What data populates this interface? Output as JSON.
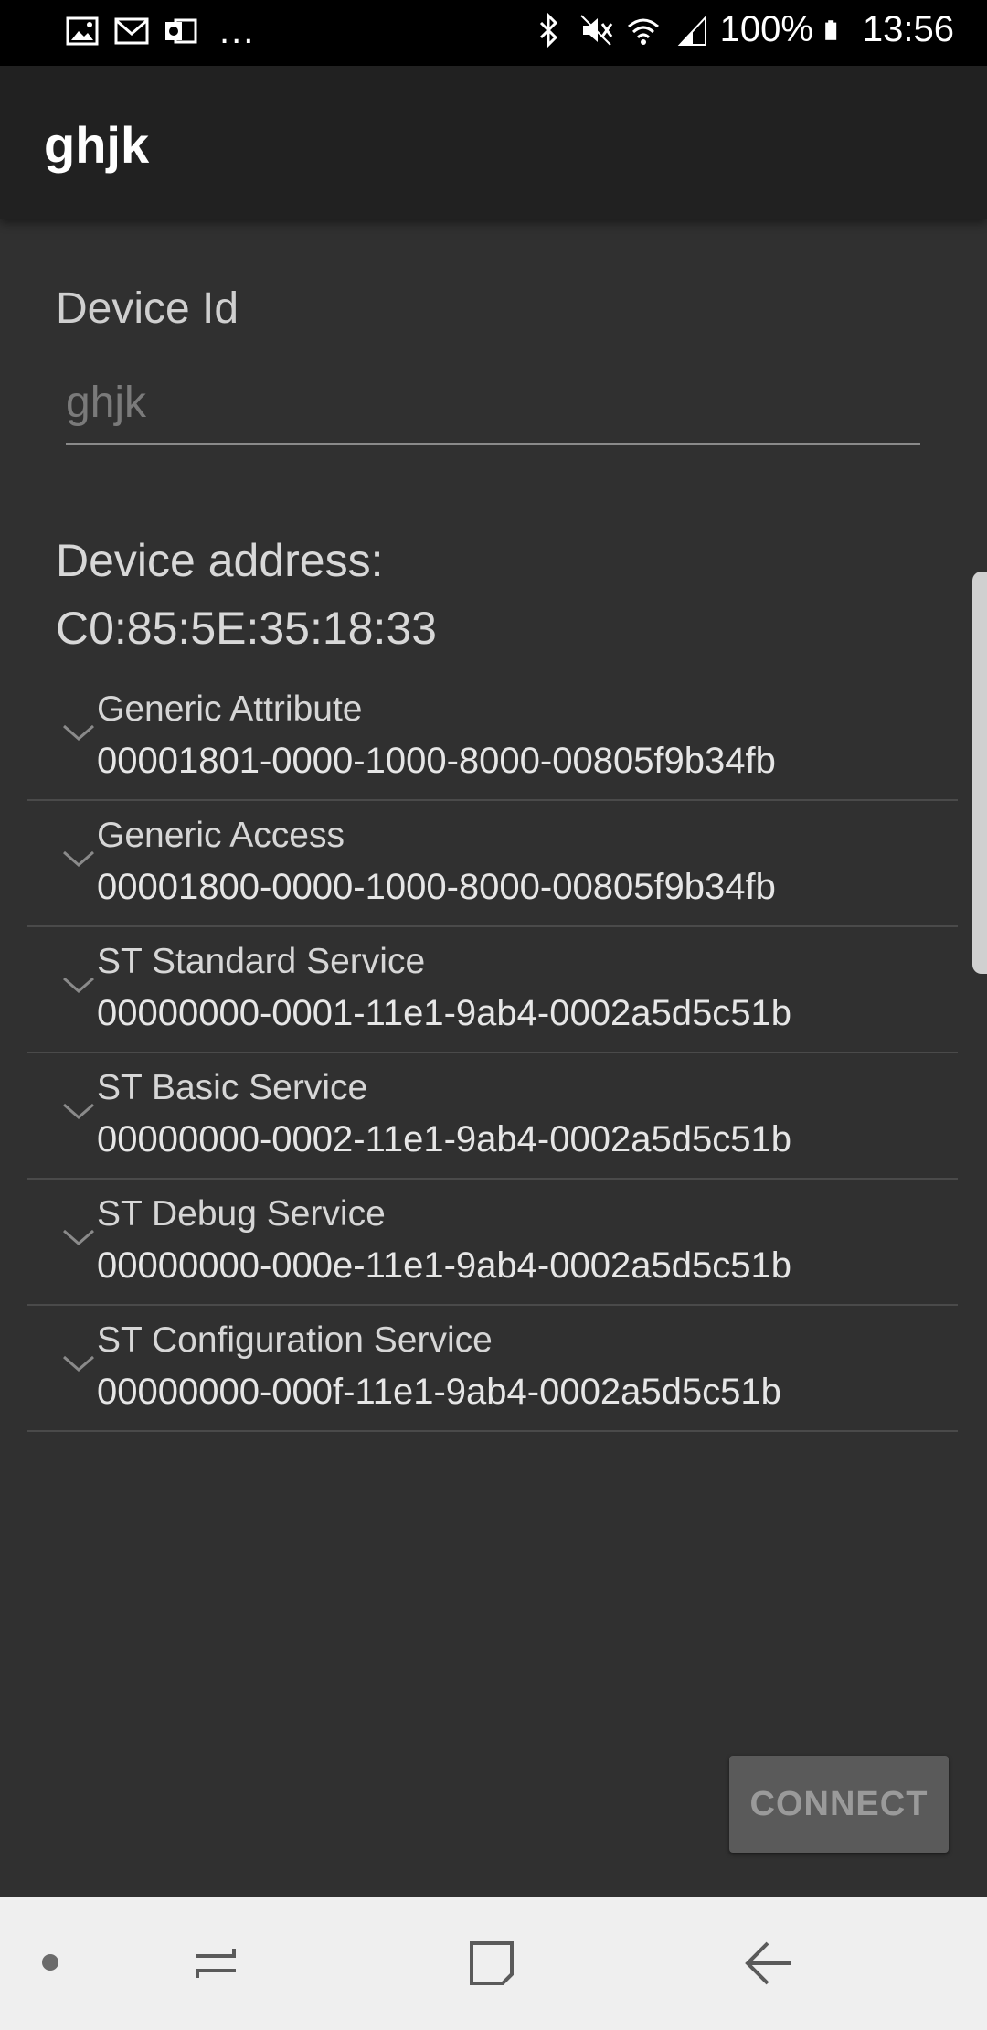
{
  "status_bar": {
    "notification_icons": [
      "image-icon",
      "gmail-icon",
      "outlook-icon"
    ],
    "overflow": "...",
    "battery": "100%",
    "time": "13:56"
  },
  "app_bar": {
    "title": "ghjk"
  },
  "form": {
    "device_id_label": "Device Id",
    "device_id_placeholder": "ghjk",
    "device_address_label": "Device address:",
    "device_address_value": "C0:85:5E:35:18:33"
  },
  "services": [
    {
      "name": "Generic Attribute",
      "uuid": "00001801-0000-1000-8000-00805f9b34fb"
    },
    {
      "name": "Generic Access",
      "uuid": "00001800-0000-1000-8000-00805f9b34fb"
    },
    {
      "name": "ST Standard Service",
      "uuid": "00000000-0001-11e1-9ab4-0002a5d5c51b"
    },
    {
      "name": "ST Basic Service",
      "uuid": "00000000-0002-11e1-9ab4-0002a5d5c51b"
    },
    {
      "name": "ST Debug Service",
      "uuid": "00000000-000e-11e1-9ab4-0002a5d5c51b"
    },
    {
      "name": "ST Configuration Service",
      "uuid": "00000000-000f-11e1-9ab4-0002a5d5c51b"
    }
  ],
  "actions": {
    "connect_label": "CONNECT"
  },
  "colors": {
    "background": "#303030",
    "app_bar": "#212121",
    "nav_bar": "#efefef"
  }
}
